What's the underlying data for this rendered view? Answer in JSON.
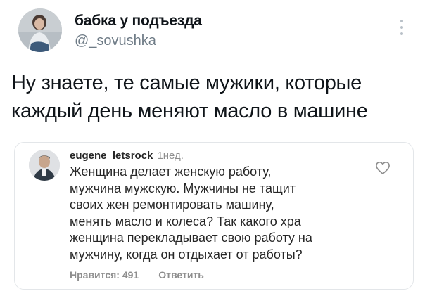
{
  "tweet": {
    "author_name": "бабка у подъезда",
    "author_handle": "@_sovushka",
    "text_line1": "Ну знаете, те самые мужики, которые",
    "text_line2": "каждый день меняют масло в машине"
  },
  "comment": {
    "username": "eugene_letsrock",
    "time": "1нед.",
    "lines": [
      "Женщина делает женскую работу,",
      "мужчина мужскую. Мужчины не тащит",
      "своих жен ремонтировать машину,",
      "менять масло и колеса? Так какого хра",
      "женщина перекладывает свою работу на",
      "мужчину, когда он отдыхает от работы?"
    ],
    "likes": "Нравится: 491",
    "reply": "Ответить"
  },
  "icons": {
    "more": "more-vertical-icon",
    "like": "heart-outline-icon"
  },
  "colors": {
    "text": "#0f1419",
    "secondary": "#6e7b86",
    "comment_text": "#262626",
    "comment_meta": "#8e8e8e"
  }
}
